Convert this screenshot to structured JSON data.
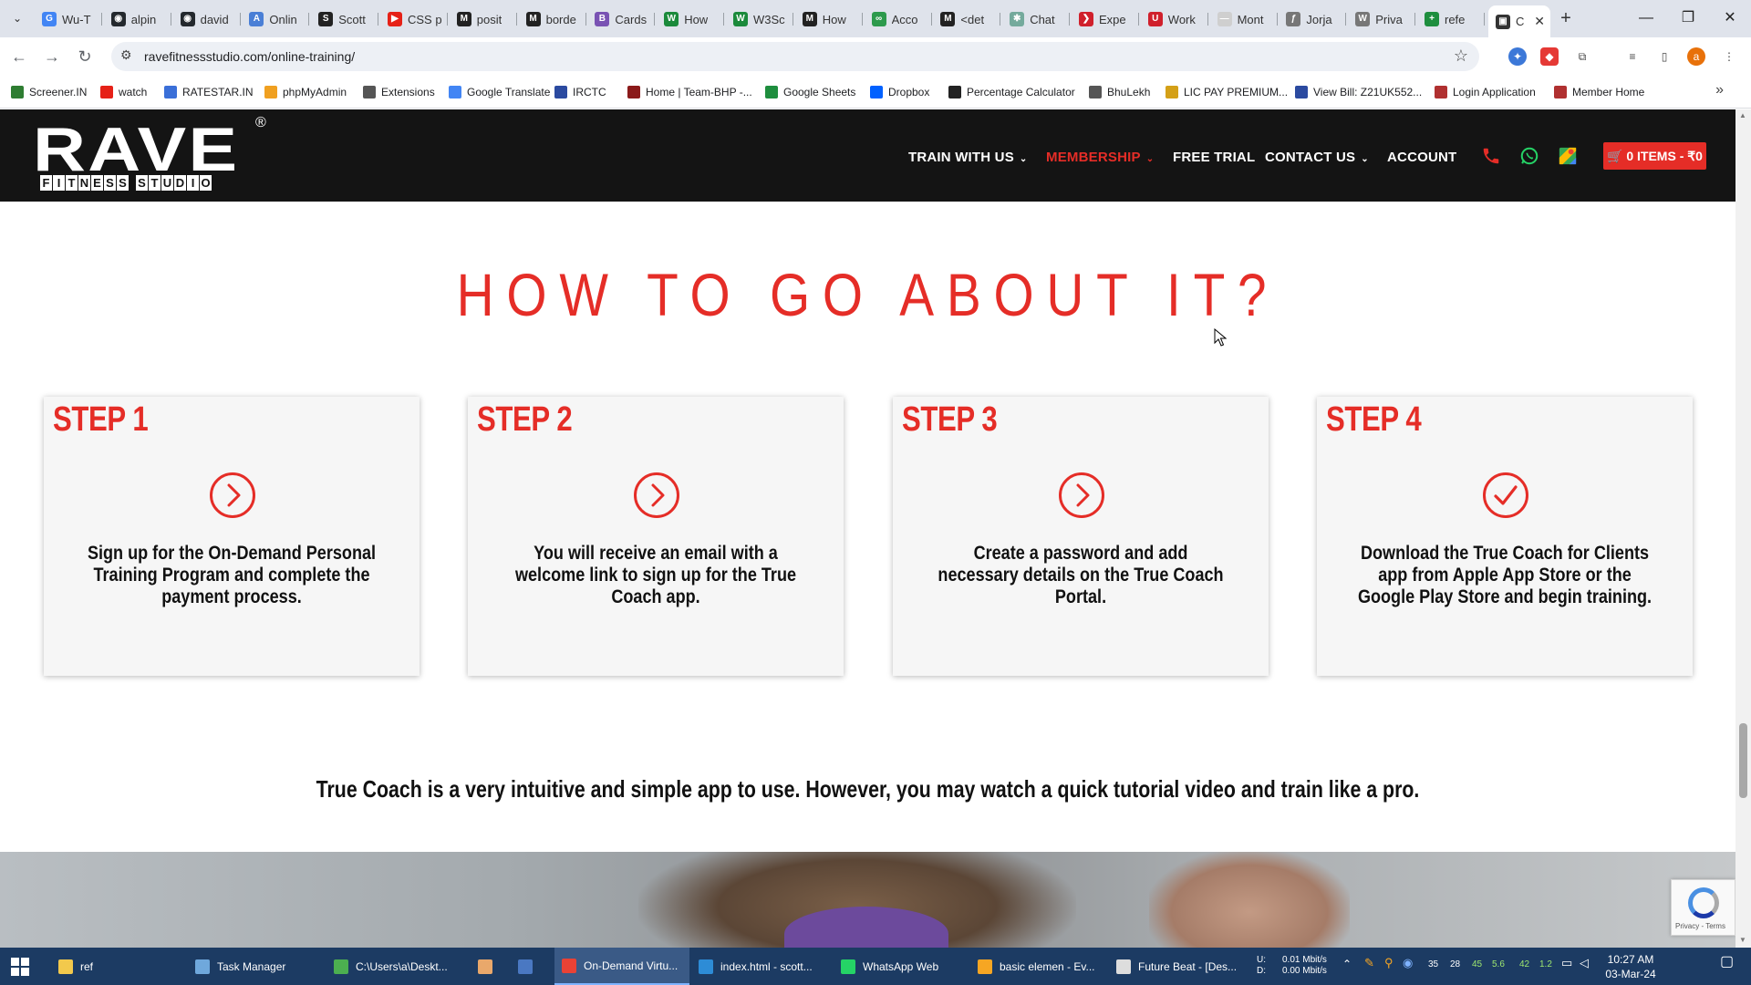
{
  "browser": {
    "tabs": [
      {
        "label": "Wu-T",
        "color": "#4285f4",
        "glyph": "G"
      },
      {
        "label": "alpin",
        "color": "#24292e",
        "glyph": "◉"
      },
      {
        "label": "david",
        "color": "#24292e",
        "glyph": "◉"
      },
      {
        "label": "Onlin",
        "color": "#4a7fd6",
        "glyph": "A"
      },
      {
        "label": "Scott",
        "color": "#222222",
        "glyph": "S"
      },
      {
        "label": "CSS p",
        "color": "#e62117",
        "glyph": "▶"
      },
      {
        "label": "posit",
        "color": "#222222",
        "glyph": "M"
      },
      {
        "label": "borde",
        "color": "#222222",
        "glyph": "M"
      },
      {
        "label": "Cards",
        "color": "#7952b3",
        "glyph": "B"
      },
      {
        "label": "How",
        "color": "#1b8a3b",
        "glyph": "W"
      },
      {
        "label": "W3Sc",
        "color": "#1b8a3b",
        "glyph": "W"
      },
      {
        "label": "How",
        "color": "#222222",
        "glyph": "M"
      },
      {
        "label": "Acco",
        "color": "#2d9a4c",
        "glyph": "∞"
      },
      {
        "label": "<det",
        "color": "#222222",
        "glyph": "M"
      },
      {
        "label": "Chat",
        "color": "#74aa9c",
        "glyph": "✱"
      },
      {
        "label": "Expe",
        "color": "#d0202c",
        "glyph": "❯"
      },
      {
        "label": "Work",
        "color": "#d0202c",
        "glyph": "U"
      },
      {
        "label": "Mont",
        "color": "#cfcfcf",
        "glyph": "—"
      },
      {
        "label": "Jorja",
        "color": "#777777",
        "glyph": "ƒ"
      },
      {
        "label": "Priva",
        "color": "#777777",
        "glyph": "W"
      },
      {
        "label": "refe",
        "color": "#1e8e3e",
        "glyph": "+"
      }
    ],
    "active_tab_label": "C",
    "url": "ravefitnessstudio.com/online-training/",
    "bookmarks": [
      {
        "label": "Screener.IN",
        "color": "#2e7d32"
      },
      {
        "label": "watch",
        "color": "#e62117"
      },
      {
        "label": "RATESTAR.IN",
        "color": "#3a6fd8"
      },
      {
        "label": "phpMyAdmin",
        "color": "#f0a020"
      },
      {
        "label": "Extensions",
        "color": "#555555"
      },
      {
        "label": "Google Translate",
        "color": "#4285f4"
      },
      {
        "label": "IRCTC",
        "color": "#2b4aa0"
      },
      {
        "label": "Home | Team-BHP -...",
        "color": "#8b1a1a"
      },
      {
        "label": "Google Sheets",
        "color": "#1e8e3e"
      },
      {
        "label": "Dropbox",
        "color": "#0061ff"
      },
      {
        "label": "Percentage Calculator",
        "color": "#222222"
      },
      {
        "label": "BhuLekh",
        "color": "#555555"
      },
      {
        "label": "LIC PAY PREMIUM...",
        "color": "#d4a017"
      },
      {
        "label": "View Bill: Z21UK552...",
        "color": "#2b4aa0"
      },
      {
        "label": "Login Application",
        "color": "#b03030"
      },
      {
        "label": "Member Home",
        "color": "#b03030"
      }
    ]
  },
  "site": {
    "logo_text": "RAVE",
    "logo_registered": "®",
    "logo_tagline": "FITNESS STUDIO",
    "nav": [
      {
        "label": "TRAIN WITH US",
        "caret": "⌄",
        "active": false
      },
      {
        "label": "MEMBERSHIP",
        "caret": "⌄",
        "active": true
      },
      {
        "label": "FREE TRIAL",
        "caret": "",
        "active": false
      },
      {
        "label": "CONTACT US",
        "caret": "⌄",
        "active": false
      },
      {
        "label": "ACCOUNT",
        "caret": "",
        "active": false
      }
    ],
    "header_icons": [
      "phone-icon",
      "whatsapp-icon",
      "map-icon"
    ],
    "cart_label": "🛒 0 ITEMS - ₹0",
    "accent_color": "#e52d27"
  },
  "section": {
    "title": "HOW TO GO ABOUT IT?",
    "steps": [
      {
        "label": "STEP 1",
        "icon": "arrow-circle-icon",
        "text": "Sign up for the On-Demand Personal Training Program and complete the payment process."
      },
      {
        "label": "STEP 2",
        "icon": "arrow-circle-icon",
        "text": "You will receive an email with a welcome link to sign up for the True Coach app."
      },
      {
        "label": "STEP 3",
        "icon": "arrow-circle-icon",
        "text": "Create a password and add necessary details on the True Coach Portal."
      },
      {
        "label": "STEP 4",
        "icon": "check-circle-icon",
        "text": "Download the True Coach for Clients app from Apple App Store or the Google Play Store and begin training."
      }
    ],
    "tagline": "True Coach is a very intuitive and simple app to use. However, you may watch a quick tutorial video and train like a pro."
  },
  "recaptcha": {
    "footer": "Privacy - Terms"
  },
  "taskbar": {
    "items": [
      {
        "label": "ref",
        "color": "#f2c94c"
      },
      {
        "label": "Task Manager",
        "color": "#6fa8dc"
      },
      {
        "label": "C:\\Users\\a\\Deskt...",
        "color": "#4caf50"
      },
      {
        "label": "",
        "color": "#e9a86b"
      },
      {
        "label": "",
        "color": "#4a78c2"
      },
      {
        "label": "On-Demand Virtu...",
        "color": "#e94235"
      },
      {
        "label": "index.html - scott...",
        "color": "#2d8cd6"
      },
      {
        "label": "WhatsApp Web",
        "color": "#25d366"
      },
      {
        "label": "basic elemen - Ev...",
        "color": "#f6a623"
      },
      {
        "label": "Future Beat - [Des...",
        "color": "#dddddd"
      }
    ],
    "net_labels": "U:\nD:",
    "net_up": "0.01 Mbit/s",
    "net_down": "0.00 Mbit/s",
    "tray_numbers": [
      "35",
      "28",
      "45",
      "5.6",
      "42",
      "1.2"
    ],
    "time": "10:27 AM",
    "date": "03-Mar-24"
  }
}
